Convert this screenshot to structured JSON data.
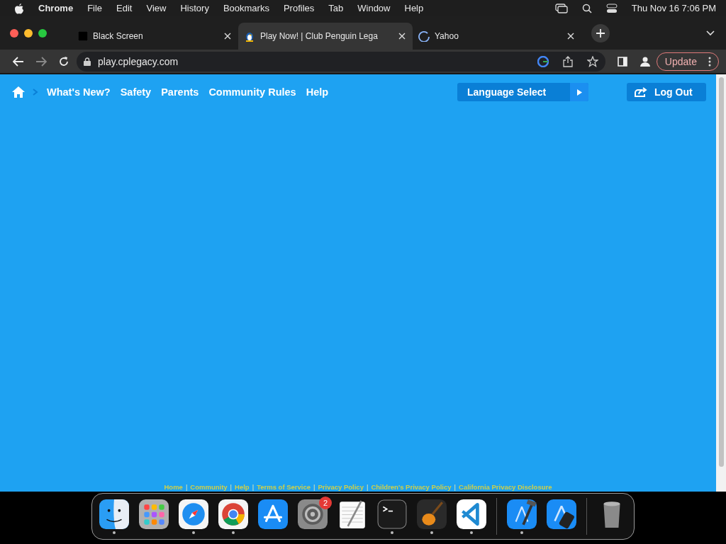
{
  "menu_bar": {
    "app": "Chrome",
    "items": [
      "File",
      "Edit",
      "View",
      "History",
      "Bookmarks",
      "Profiles",
      "Tab",
      "Window",
      "Help"
    ],
    "clock": "Thu Nov 16  7:06 PM"
  },
  "tabs": [
    {
      "title": "Black Screen",
      "selected": false,
      "kind": "square"
    },
    {
      "title": "Play Now! | Club Penguin Lega",
      "selected": true,
      "kind": "penguin"
    },
    {
      "title": "Yahoo",
      "selected": false,
      "kind": "loading"
    }
  ],
  "toolbar": {
    "url": "play.cplegacy.com",
    "update": "Update"
  },
  "site_nav": {
    "links": [
      "What's New?",
      "Safety",
      "Parents",
      "Community Rules",
      "Help"
    ],
    "language": "Language Select",
    "logout": "Log Out"
  },
  "footer": [
    {
      "kind": "link",
      "text": "Home"
    },
    {
      "kind": "separator",
      "text": "|"
    },
    {
      "kind": "link",
      "text": "Community"
    },
    {
      "kind": "separator",
      "text": "|"
    },
    {
      "kind": "link",
      "text": "Help"
    },
    {
      "kind": "separator",
      "text": "|"
    },
    {
      "kind": "link",
      "text": "Terms of Service"
    },
    {
      "kind": "separator",
      "text": "|"
    },
    {
      "kind": "link",
      "text": "Privacy Policy"
    },
    {
      "kind": "separator",
      "text": "|"
    },
    {
      "kind": "link",
      "text": "Children's Privacy Policy"
    },
    {
      "kind": "separator",
      "text": "|"
    },
    {
      "kind": "link",
      "text": "California Privacy Disclosure"
    }
  ],
  "dock": [
    {
      "kind": "finder",
      "running": true
    },
    {
      "kind": "launchpad",
      "running": false
    },
    {
      "kind": "safari",
      "running": true
    },
    {
      "kind": "chrome",
      "running": true
    },
    {
      "kind": "appstore",
      "running": false
    },
    {
      "kind": "settings",
      "running": false,
      "badge": "2"
    },
    {
      "kind": "textedit",
      "running": false
    },
    {
      "kind": "terminal",
      "running": true
    },
    {
      "kind": "guitar",
      "running": true
    },
    {
      "kind": "vscode",
      "running": true
    },
    {
      "kind": "divider"
    },
    {
      "kind": "xcode",
      "running": true
    },
    {
      "kind": "simulator",
      "running": false
    },
    {
      "kind": "divider"
    },
    {
      "kind": "trash",
      "running": false
    }
  ]
}
